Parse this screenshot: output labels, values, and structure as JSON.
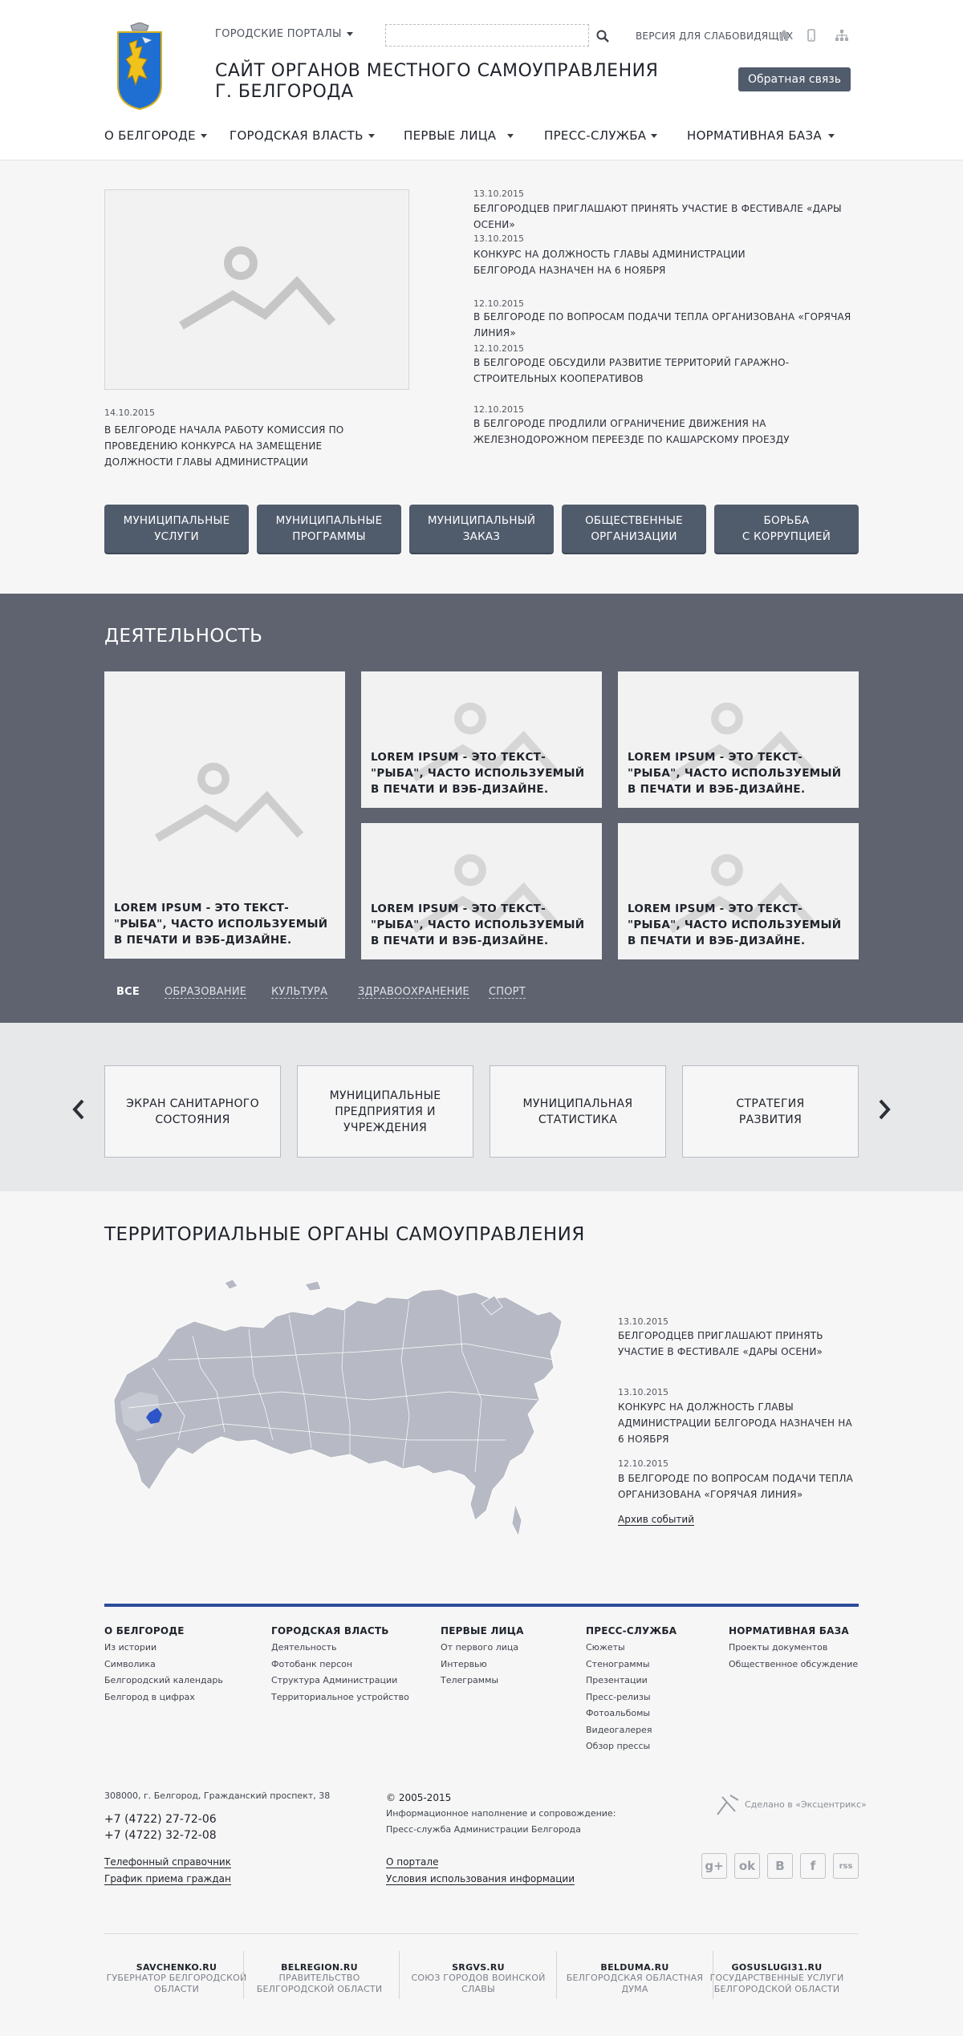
{
  "header": {
    "portals": "ГОРОДСКИЕ ПОРТАЛЫ",
    "search_placeholder": "",
    "vision": "ВЕРСИЯ ДЛЯ СЛАБОВИДЯЩИХ",
    "title_line1": "САЙТ ОРГАНОВ МЕСТНОГО САМОУПРАВЛЕНИЯ",
    "title_line2": "Г. БЕЛГОРОДА",
    "feedback": "Обратная связь",
    "icons": [
      "home-icon",
      "mobile-icon",
      "sitemap-icon"
    ]
  },
  "nav": [
    "О БЕЛГОРОДЕ",
    "ГОРОДСКАЯ ВЛАСТЬ",
    "ПЕРВЫЕ ЛИЦА",
    "ПРЕСС-СЛУЖБА",
    "НОРМАТИВНАЯ БАЗА"
  ],
  "main_news": {
    "date": "14.10.2015",
    "title": "В БЕЛГОРОДЕ НАЧАЛА РАБОТУ КОМИССИЯ ПО ПРОВЕДЕНИЮ КОНКУРСА НА ЗАМЕЩЕНИЕ ДОЛЖНОСТИ ГЛАВЫ АДМИНИСТРАЦИИ"
  },
  "news": [
    {
      "date": "13.10.2015",
      "title": "БЕЛГОРОДЦЕВ ПРИГЛАШАЮТ ПРИНЯТЬ УЧАСТИЕ В ФЕСТИВАЛЕ «ДАРЫ ОСЕНИ»"
    },
    {
      "date": "13.10.2015",
      "title": "КОНКУРС НА ДОЛЖНОСТЬ ГЛАВЫ АДМИНИСТРАЦИИ БЕЛГОРОДА НАЗНАЧЕН НА 6 НОЯБРЯ"
    },
    {
      "date": "12.10.2015",
      "title": "В БЕЛГОРОДЕ ПО ВОПРОСАМ ПОДАЧИ ТЕПЛА ОРГАНИЗОВАНА «ГОРЯЧАЯ ЛИНИЯ»"
    },
    {
      "date": "12.10.2015",
      "title": "В БЕЛГОРОДЕ ОБСУДИЛИ РАЗВИТИЕ ТЕРРИТОРИЙ ГАРАЖНО-СТРОИТЕЛЬНЫХ КООПЕРАТИВОВ"
    },
    {
      "date": "12.10.2015",
      "title": "В БЕЛГОРОДЕ ПРОДЛИЛИ ОГРАНИЧЕНИЕ ДВИЖЕНИЯ НА ЖЕЛЕЗНОДОРОЖНОМ ПЕРЕЕЗДЕ ПО КАШАРСКОМУ ПРОЕЗДУ"
    }
  ],
  "services": [
    [
      "МУНИЦИПАЛЬНЫЕ",
      "УСЛУГИ"
    ],
    [
      "МУНИЦИПАЛЬНЫЕ",
      "ПРОГРАММЫ"
    ],
    [
      "МУНИЦИПАЛЬНЫЙ",
      "ЗАКАЗ"
    ],
    [
      "ОБЩЕСТВЕННЫЕ",
      "ОРГАНИЗАЦИИ"
    ],
    [
      "БОРЬБА",
      "С КОРРУПЦИЕЙ"
    ]
  ],
  "activity": {
    "heading": "ДЕЯТЕЛЬНОСТЬ",
    "card_text": "LOREM IPSUM - ЭТО ТЕКСТ-\"РЫБА\", ЧАСТО ИСПОЛЬЗУЕМЫЙ В ПЕЧАТИ И ВЭБ-ДИЗАЙНЕ.",
    "filters": [
      "ВСЕ",
      "ОБРАЗОВАНИЕ",
      "КУЛЬТУРА",
      "ЗДРАВООХРАНЕНИЕ",
      "СПОРТ"
    ]
  },
  "carousel": [
    [
      "ЭКРАН САНИТАРНОГО",
      "СОСТОЯНИЯ"
    ],
    [
      "МУНИЦИПАЛЬНЫЕ",
      "ПРЕДПРИЯТИЯ И",
      "УЧРЕЖДЕНИЯ"
    ],
    [
      "МУНИЦИПАЛЬНАЯ",
      "СТАТИСТИКА"
    ],
    [
      "СТРАТЕГИЯ",
      "РАЗВИТИЯ"
    ]
  ],
  "territory": {
    "heading": "ТЕРРИТОРИАЛЬНЫЕ ОРГАНЫ САМОУПРАВЛЕНИЯ",
    "news": [
      {
        "date": "13.10.2015",
        "title": "БЕЛГОРОДЦЕВ ПРИГЛАШАЮТ ПРИНЯТЬ УЧАСТИЕ В ФЕСТИВАЛЕ «ДАРЫ ОСЕНИ»"
      },
      {
        "date": "13.10.2015",
        "title": "КОНКУРС НА ДОЛЖНОСТЬ ГЛАВЫ АДМИНИСТРАЦИИ БЕЛГОРОДА НАЗНАЧЕН НА 6 НОЯБРЯ"
      },
      {
        "date": "12.10.2015",
        "title": "В БЕЛГОРОДЕ ПО ВОПРОСАМ ПОДАЧИ ТЕПЛА ОРГАНИЗОВАНА «ГОРЯЧАЯ ЛИНИЯ»"
      }
    ],
    "archive": "Архив событий",
    "highlight_color": "#2e55c8"
  },
  "footer": {
    "columns": [
      {
        "title": "О БЕЛГОРОДЕ",
        "items": [
          "Из истории",
          "Символика",
          "Белгородский календарь",
          "Белгород в цифрах"
        ]
      },
      {
        "title": "ГОРОДСКАЯ ВЛАСТЬ",
        "items": [
          "Деятельность",
          "Фотобанк персон",
          "Структура Администрации",
          "Территориальное устройство"
        ]
      },
      {
        "title": "ПЕРВЫЕ ЛИЦА",
        "items": [
          "От первого лица",
          "Интервью",
          "Телеграммы"
        ]
      },
      {
        "title": "ПРЕСС-СЛУЖБА",
        "items": [
          "Сюжеты",
          "Стенограммы",
          "Презентации",
          "Пресс-релизы",
          "Фотоальбомы",
          "Видеогалерея",
          "Обзор прессы"
        ]
      },
      {
        "title": "НОРМАТИВНАЯ БАЗА",
        "items": [
          "Проекты документов",
          "Общественное обсуждение"
        ]
      }
    ],
    "address": "308000, г. Белгород, Гражданский проспект, 38",
    "phone1": "+7 (4722) 27-72-06",
    "phone2": "+7 (4722) 32-72-08",
    "link_directory": "Телефонный справочник",
    "link_schedule": "График приема граждан",
    "copyright": "© 2005-2015",
    "info1": "Информационное наполнение и сопровождение:",
    "info2": "Пресс-служба Администрации Белгорода",
    "link_about": "О портале",
    "link_terms": "Условия использования информации",
    "made_by": "Сделано в «Эксцентрикс»",
    "social": [
      "g+",
      "ok",
      "В",
      "f",
      "rss"
    ],
    "partners": [
      {
        "url": "SAVCHENKO.RU",
        "name": [
          "ГУБЕРНАТОР БЕЛГОРОДСКОЙ",
          "ОБЛАСТИ"
        ]
      },
      {
        "url": "BELREGION.RU",
        "name": [
          "ПРАВИТЕЛЬСТВО",
          "БЕЛГОРОДСКОЙ ОБЛАСТИ"
        ]
      },
      {
        "url": "SRGVS.RU",
        "name": [
          "СОЮЗ ГОРОДОВ ВОИНСКОЙ",
          "СЛАВЫ"
        ]
      },
      {
        "url": "BELDUMA.RU",
        "name": [
          "БЕЛГОРОДСКАЯ ОБЛАСТНАЯ",
          "ДУМА"
        ]
      },
      {
        "url": "GOSUSLUGI31.RU",
        "name": [
          "ГОСУДАРСТВЕННЫЕ УСЛУГИ",
          "БЕЛГОРОДСКОЙ ОБЛАСТИ"
        ]
      }
    ]
  }
}
